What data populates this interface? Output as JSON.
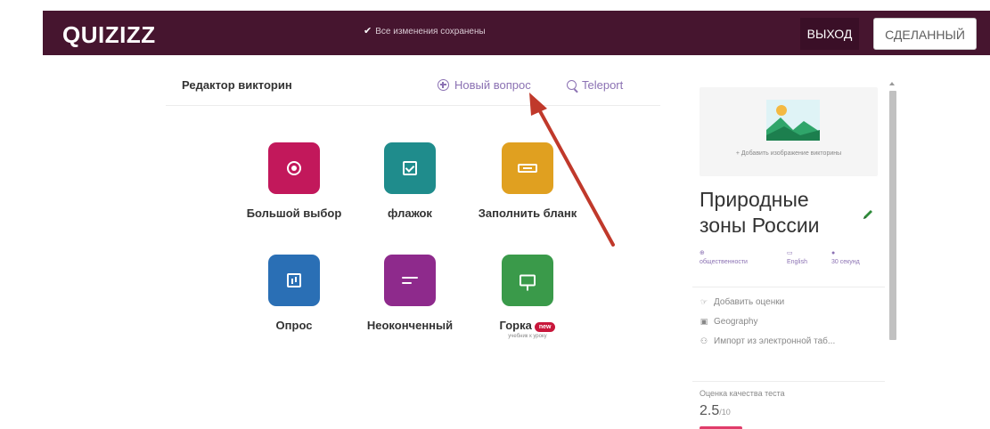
{
  "topbar": {
    "logo": "QUIZIZZ",
    "saved_status": "Все изменения сохранены",
    "exit_label": "ВЫХОД",
    "done_label": "СДЕЛАННЫЙ",
    "bar_color": "#46152f"
  },
  "editor": {
    "title": "Редактор викторин",
    "new_question": "Новый вопрос",
    "teleport": "Teleport"
  },
  "question_types": [
    {
      "label": "Большой выбор",
      "color": "#c2185b",
      "icon": "multiple-choice-icon"
    },
    {
      "label": "флажок",
      "color": "#1f8c8c",
      "icon": "checkbox-icon"
    },
    {
      "label": "Заполнить бланк",
      "color": "#e0a020",
      "icon": "fill-blank-icon"
    },
    {
      "label": "Опрос",
      "color": "#2a6fb5",
      "icon": "poll-icon"
    },
    {
      "label": "Неоконченный",
      "color": "#8e2a8c",
      "icon": "open-ended-icon"
    },
    {
      "label": "Горка",
      "color": "#3a9a4a",
      "icon": "slide-icon",
      "badge": "new",
      "sub": "учебник к уроку"
    }
  ],
  "panel": {
    "cover_text": "+ Добавить изображение викторины",
    "quiz_title": "Природные зоны России",
    "meta": [
      {
        "icon": "⊕",
        "text": "общественности"
      },
      {
        "icon": "▭",
        "text": "English"
      },
      {
        "icon": "●",
        "text": "30 секунд"
      }
    ],
    "links": [
      {
        "icon": "☞",
        "text": "Добавить оценки"
      },
      {
        "icon": "▣",
        "text": "Geography"
      },
      {
        "icon": "⚇",
        "text": "Импорт из электронной таб..."
      }
    ],
    "quality_label": "Оценка качества теста",
    "quality_score": "2.5",
    "quality_max": "/10"
  },
  "annotation": {
    "arrow_color": "#c0392b"
  }
}
